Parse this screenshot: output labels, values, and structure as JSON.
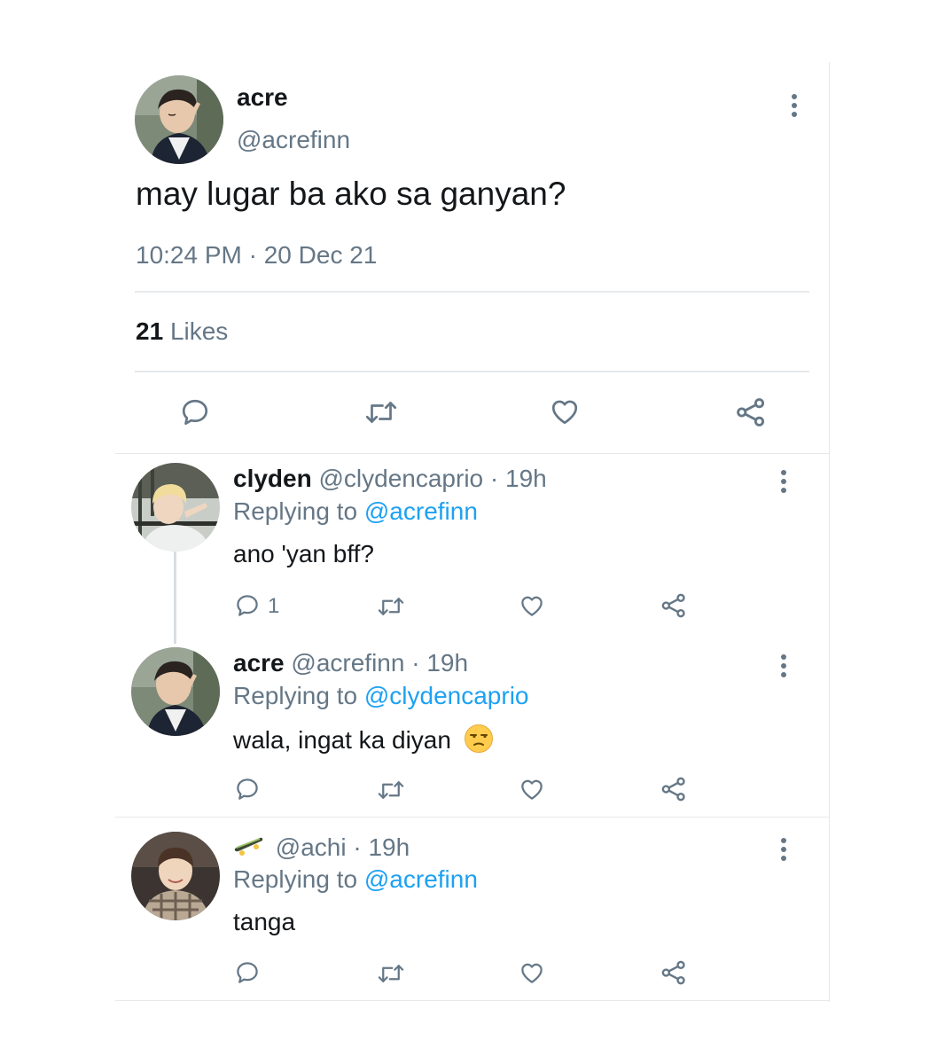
{
  "main_tweet": {
    "name": "acre",
    "handle": "@acrefinn",
    "text": "may lugar ba ako sa ganyan?",
    "timestamp": "10:24 PM · 20 Dec 21",
    "likes_count": "21",
    "likes_label": "Likes",
    "actions": [
      "reply-icon",
      "retweet-icon",
      "like-icon",
      "share-icon"
    ]
  },
  "replies": [
    {
      "name": "clyden",
      "handle": "@clydencaprio",
      "time": "· 19h",
      "replying_prefix": "Replying to",
      "replying_to": "@acrefinn",
      "text": "ano 'yan bff?",
      "reply_count": "1"
    },
    {
      "name": "acre",
      "handle": "@acrefinn",
      "time": "· 19h",
      "replying_prefix": "Replying to",
      "replying_to": "@clydencaprio",
      "text": "wala, ingat ka diyan",
      "emoji": "unamused-face-emoji"
    },
    {
      "name": "",
      "name_icon": "skateboard-icon",
      "handle": "@achi",
      "time": "· 19h",
      "replying_prefix": "Replying to",
      "replying_to": "@acrefinn",
      "text": "tanga"
    }
  ],
  "colors": {
    "text": "#14171a",
    "secondary": "#657786",
    "link": "#1da1f2",
    "divider": "#e6e9eb"
  }
}
